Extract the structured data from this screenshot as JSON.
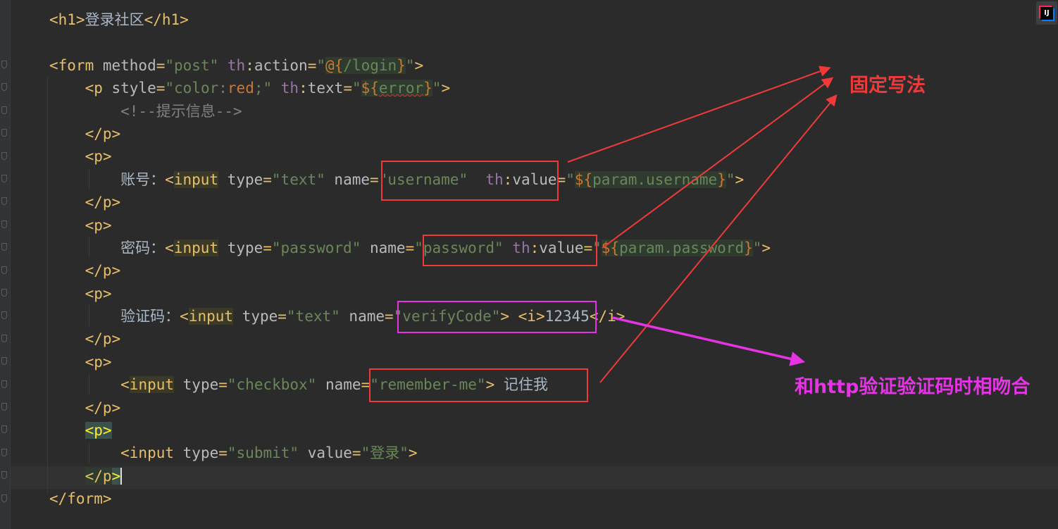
{
  "code_lines": [
    [
      [
        "tag",
        "<h1>"
      ],
      [
        "txt",
        "登录社区"
      ],
      [
        "tag",
        "</h1>"
      ]
    ],
    [],
    [
      [
        "tag",
        "<form "
      ],
      [
        "attr",
        "method"
      ],
      [
        "tag",
        "="
      ],
      [
        "str",
        "\"post\" "
      ],
      [
        "ns",
        "th"
      ],
      [
        "tag",
        ":"
      ],
      [
        "attr",
        "action"
      ],
      [
        "tag",
        "="
      ],
      [
        "str",
        "\""
      ],
      [
        "red expr",
        "@{"
      ],
      [
        "str expr",
        "/login"
      ],
      [
        "red expr",
        "}"
      ],
      [
        "str",
        "\""
      ],
      [
        "tag",
        ">"
      ]
    ],
    [
      [
        "tag",
        "    <p "
      ],
      [
        "attr",
        "style"
      ],
      [
        "tag",
        "="
      ],
      [
        "str",
        "\"color:"
      ],
      [
        "red",
        "red"
      ],
      [
        "str",
        ";\" "
      ],
      [
        "ns",
        "th"
      ],
      [
        "tag",
        ":"
      ],
      [
        "attr",
        "text"
      ],
      [
        "tag",
        "="
      ],
      [
        "str",
        "\""
      ],
      [
        "red expr",
        "${"
      ],
      [
        "str expr err",
        "error"
      ],
      [
        "red expr",
        "}"
      ],
      [
        "str",
        "\""
      ],
      [
        "tag",
        ">"
      ]
    ],
    [
      [
        "cmt",
        "        <!--提示信息-->"
      ]
    ],
    [
      [
        "tag",
        "    </p>"
      ]
    ],
    [
      [
        "tag",
        "    <p>"
      ]
    ],
    [
      [
        "txt",
        "        账号："
      ],
      [
        "tag",
        "<"
      ],
      [
        "tag hl-input",
        "input"
      ],
      [
        "attr",
        " type"
      ],
      [
        "tag",
        "="
      ],
      [
        "str",
        "\"text\" "
      ],
      [
        "attr",
        "name"
      ],
      [
        "tag",
        "="
      ],
      [
        "str",
        "\"username\"  "
      ],
      [
        "ns",
        "th"
      ],
      [
        "tag",
        ":"
      ],
      [
        "attr",
        "value"
      ],
      [
        "tag",
        "="
      ],
      [
        "str",
        "\""
      ],
      [
        "red expr",
        "${"
      ],
      [
        "str expr",
        "param.username"
      ],
      [
        "red expr",
        "}"
      ],
      [
        "str",
        "\""
      ],
      [
        "tag",
        ">"
      ]
    ],
    [
      [
        "tag",
        "    </p>"
      ]
    ],
    [
      [
        "tag",
        "    <p>"
      ]
    ],
    [
      [
        "txt",
        "        密码："
      ],
      [
        "tag",
        "<"
      ],
      [
        "tag hl-input",
        "input"
      ],
      [
        "attr",
        " type"
      ],
      [
        "tag",
        "="
      ],
      [
        "str",
        "\"password\" "
      ],
      [
        "attr",
        "name"
      ],
      [
        "tag",
        "="
      ],
      [
        "str",
        "\"password\" "
      ],
      [
        "ns",
        "th"
      ],
      [
        "tag",
        ":"
      ],
      [
        "attr",
        "value"
      ],
      [
        "tag",
        "="
      ],
      [
        "str",
        "\""
      ],
      [
        "red expr",
        "${"
      ],
      [
        "str expr",
        "param.password"
      ],
      [
        "red expr",
        "}"
      ],
      [
        "str",
        "\""
      ],
      [
        "tag",
        ">"
      ]
    ],
    [
      [
        "tag",
        "    </p>"
      ]
    ],
    [
      [
        "tag",
        "    <p>"
      ]
    ],
    [
      [
        "txt",
        "        验证码："
      ],
      [
        "tag",
        "<"
      ],
      [
        "tag hl-input",
        "input"
      ],
      [
        "attr",
        " type"
      ],
      [
        "tag",
        "="
      ],
      [
        "str",
        "\"text\" "
      ],
      [
        "attr",
        "name"
      ],
      [
        "tag",
        "="
      ],
      [
        "str",
        "\"verifyCode\""
      ],
      [
        "tag",
        "> <i>"
      ],
      [
        "txt",
        "12345"
      ],
      [
        "tag",
        "</i>"
      ]
    ],
    [
      [
        "tag",
        "    </p>"
      ]
    ],
    [
      [
        "tag",
        "    <p>"
      ]
    ],
    [
      [
        "tag",
        "        <"
      ],
      [
        "tag hl-input",
        "input"
      ],
      [
        "attr",
        " type"
      ],
      [
        "tag",
        "="
      ],
      [
        "str",
        "\"checkbox\" "
      ],
      [
        "attr",
        "name"
      ],
      [
        "tag",
        "="
      ],
      [
        "str",
        "\"remember-me\""
      ],
      [
        "tag",
        "> "
      ],
      [
        "txt",
        "记住我"
      ]
    ],
    [
      [
        "tag",
        "    </p>"
      ]
    ],
    [
      [
        "tag",
        "    "
      ],
      [
        "p-hl",
        "<p>"
      ]
    ],
    [
      [
        "tag",
        "        <input "
      ],
      [
        "attr",
        "type"
      ],
      [
        "tag",
        "="
      ],
      [
        "str",
        "\"submit\" "
      ],
      [
        "attr",
        "value"
      ],
      [
        "tag",
        "="
      ],
      [
        "str",
        "\"登录\""
      ],
      [
        "tag",
        ">"
      ]
    ],
    [
      [
        "tag",
        "    "
      ],
      [
        "tag expr",
        "</p"
      ],
      [
        "p-hl caret",
        ">"
      ]
    ],
    [
      [
        "tag",
        "</form>"
      ]
    ]
  ],
  "annotations": {
    "fixed_syntax": "固定写法",
    "matches_http_verify_code": "和http验证验证码时相吻合"
  },
  "colors": {
    "editor_bg": "#2b2b2b",
    "tag": "#e8bf6a",
    "attribute": "#bababa",
    "string": "#6a8759",
    "namespace": "#9876aa",
    "keyword": "#cc7832",
    "comment": "#808080",
    "annotation_red": "#f03a3a",
    "annotation_magenta": "#e434e4"
  },
  "icons": {
    "ide_logo": "intellij-idea-icon"
  }
}
